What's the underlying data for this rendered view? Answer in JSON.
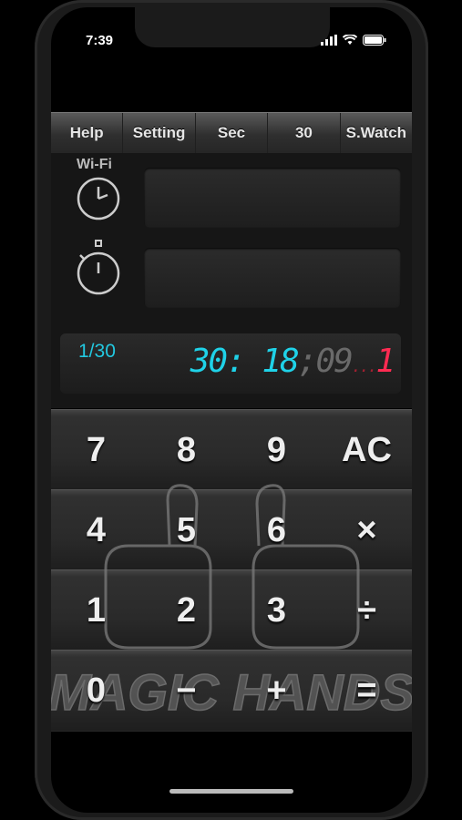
{
  "status": {
    "time": "7:39"
  },
  "toolbar": {
    "items": [
      "Help",
      "Setting",
      "Sec",
      "30",
      "S.Watch"
    ]
  },
  "info": {
    "wifi_label": "Wi-Fi"
  },
  "display": {
    "count": "1/30",
    "timer_main": "30: 18",
    "timer_sec": ";09",
    "timer_dots": "...",
    "timer_red": "1",
    "colors": {
      "cyan": "#1fd2e8",
      "red": "#ff2b52"
    }
  },
  "keypad": {
    "rows": [
      [
        "7",
        "8",
        "9",
        "AC"
      ],
      [
        "4",
        "5",
        "6",
        "×"
      ],
      [
        "1",
        "2",
        "3",
        "÷"
      ],
      [
        "0",
        "−",
        "+",
        "="
      ]
    ]
  },
  "logo": {
    "text": "MAGIC HANDS"
  }
}
